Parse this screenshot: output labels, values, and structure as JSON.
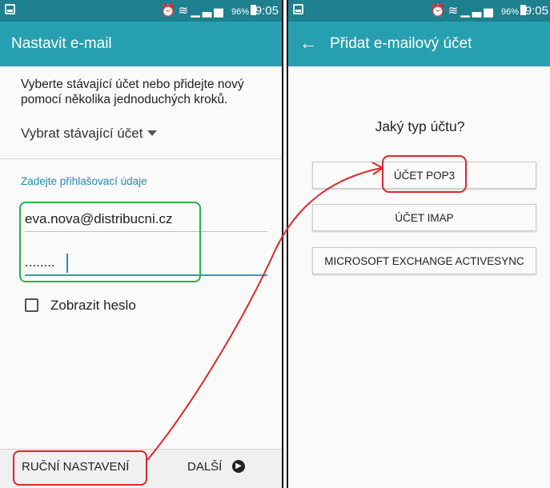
{
  "left_screen": {
    "status_bar": {
      "percent": "96%",
      "time": "9:05"
    },
    "title": "Nastavit e-mail",
    "intro": "Vyberte stávající účet nebo přidejte nový pomocí několika jednoduchých kroků.",
    "select_existing": "Vybrat stávající účet",
    "section_label": "Zadejte přihlašovací údaje",
    "email_value": "eva.nova@distribucni.cz",
    "password_value": "........",
    "show_password_label": "Zobrazit heslo",
    "manual_setup": "RUČNÍ NASTAVENÍ",
    "next": "DALŠÍ"
  },
  "right_screen": {
    "status_bar": {
      "percent": "96%",
      "time": "9:05"
    },
    "title": "Přidat e-mailový účet",
    "question": "Jaký typ účtu?",
    "buttons": [
      "ÚČET POP3",
      "ÚČET IMAP",
      "MICROSOFT EXCHANGE ACTIVESYNC"
    ]
  },
  "colors": {
    "status_bar": "#1e7f8e",
    "app_bar": "#26a0b0",
    "accent": "#1f8fb0",
    "highlight_red": "#e0272a",
    "highlight_green": "#2bb24c"
  }
}
